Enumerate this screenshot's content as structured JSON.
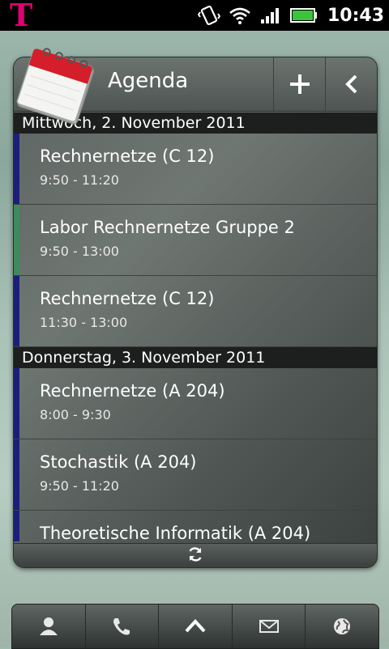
{
  "status_bar": {
    "carrier_logo": "T",
    "clock": "10:43",
    "icons": [
      "vibrate-icon",
      "wifi-icon",
      "signal-icon",
      "battery-icon"
    ]
  },
  "widget": {
    "title": "Agenda",
    "header_buttons": [
      "add-icon",
      "back-chevron-icon"
    ],
    "days": [
      {
        "header": "Mittwoch, 2. November 2011",
        "events": [
          {
            "title": "Rechnernetze (C 12)",
            "time": "9:50 - 11:20",
            "color": "#1a1f7a"
          },
          {
            "title": "Labor Rechnernetze Gruppe 2",
            "time": "9:50 - 13:00",
            "color": "#3f8a5c"
          },
          {
            "title": "Rechnernetze (C 12)",
            "time": "11:30 - 13:00",
            "color": "#1a1f7a"
          }
        ]
      },
      {
        "header": "Donnerstag, 3. November 2011",
        "events": [
          {
            "title": "Rechnernetze (A 204)",
            "time": "8:00 - 9:30",
            "color": "#1a1f7a"
          },
          {
            "title": "Stochastik (A 204)",
            "time": "9:50 - 11:20",
            "color": "#1a1f7a"
          },
          {
            "title": "Theoretische Informatik (A 204)",
            "time": "",
            "color": "#1a1f7a"
          }
        ]
      }
    ],
    "footer_icon": "refresh-icon"
  },
  "dock": {
    "items": [
      "contacts-icon",
      "phone-icon",
      "app-drawer-icon",
      "messages-icon",
      "browser-icon"
    ]
  }
}
